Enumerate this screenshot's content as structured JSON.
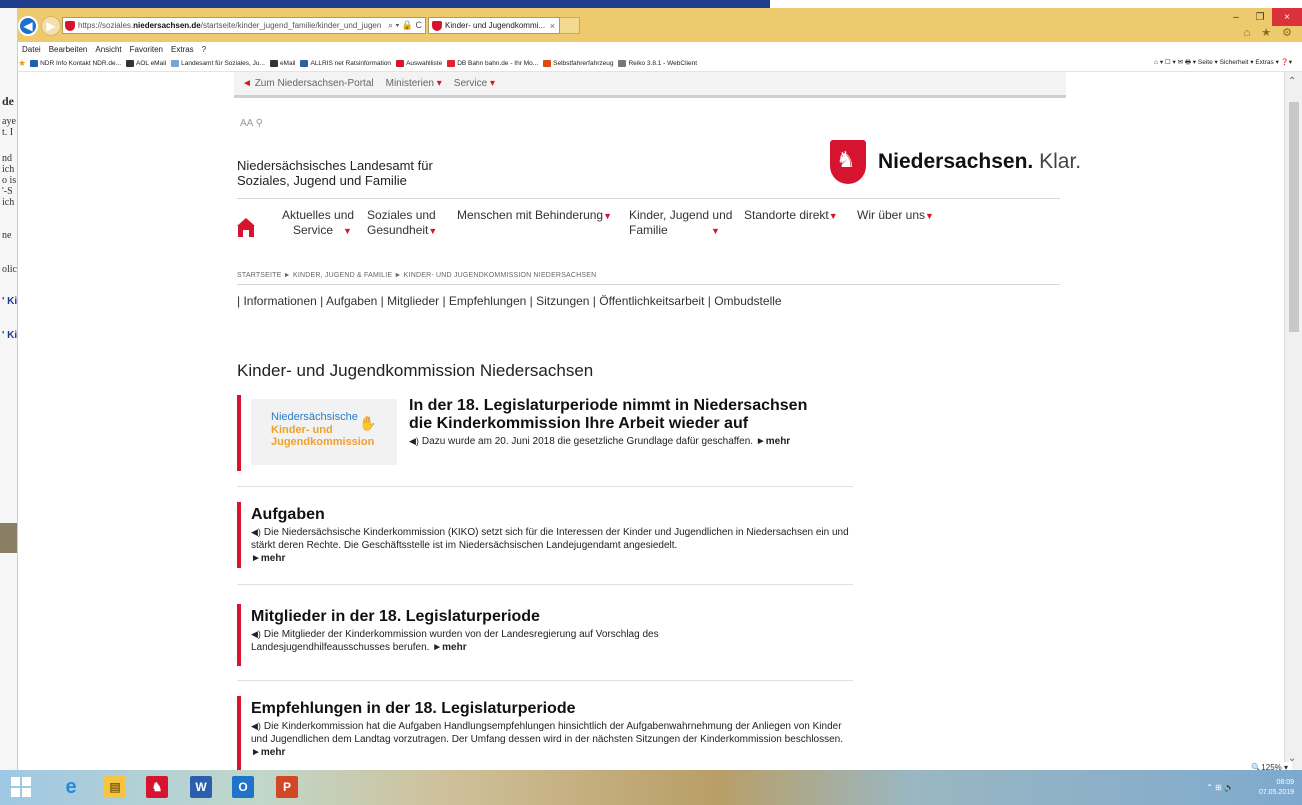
{
  "browser": {
    "url_prefix": "https://soziales.",
    "url_domain": "niedersachsen.de",
    "url_rest": "/startseite/kinder_jugend_familie/kinder_und_jugen",
    "addr_icons": "⌕ ▾ 🔒 C",
    "tab_title": "Kinder- und Jugendkommi...",
    "tab_close": "×",
    "minimize": "–",
    "maximize": "❐",
    "close": "×",
    "right_icons": "⌂ ★ ⚙"
  },
  "menubar": [
    "Datei",
    "Bearbeiten",
    "Ansicht",
    "Favoriten",
    "Extras",
    "?"
  ],
  "favorites": [
    {
      "label": "NDR Info Kontakt NDR.de...",
      "color": "#1f5fb0"
    },
    {
      "label": "AOL eMail",
      "color": "#333333"
    },
    {
      "label": "Landesamt für Soziales, Ju...",
      "color": "#7aa4d6"
    },
    {
      "label": "eMail",
      "color": "#333333"
    },
    {
      "label": "ALLRIS net Ratsinformation",
      "color": "#2b5fad"
    },
    {
      "label": "Auswahlliste",
      "color": "#d7142f"
    },
    {
      "label": "DB Bahn bahn.de - Ihr Mo...",
      "color": "#e0242f"
    },
    {
      "label": "Selbstfahrerfahrzeug",
      "color": "#d94d13"
    },
    {
      "label": "Reiko 3.8.1 - WebClient",
      "color": "#777777"
    }
  ],
  "commandbar": "⌂ ▾  ☐ ▾  ✉  🖶 ▾  Seite ▾  Sicherheit ▾  Extras ▾  ❓▾",
  "page": {
    "portal_link": "Zum Niedersachsen-Portal",
    "ministerien": "Ministerien",
    "service": "Service",
    "tools": "AA  ⚲",
    "org_line1": "Niedersächsisches Landesamt für",
    "org_line2": "Soziales, Jugend und Familie",
    "brand_bold": "Niedersachsen.",
    "brand_light": "Klar.",
    "nav": [
      {
        "l1": "Aktuelles und",
        "l2": "Service"
      },
      {
        "l1": "Soziales und",
        "l2": "Gesundheit"
      },
      {
        "l1": "Menschen mit Behinderung",
        "l2": ""
      },
      {
        "l1": "Kinder, Jugend und",
        "l2": "Familie"
      },
      {
        "l1": "Standorte direkt",
        "l2": ""
      },
      {
        "l1": "Wir über uns",
        "l2": ""
      }
    ],
    "breadcrumb": "STARTSEITE   ► KINDER, JUGEND & FAMILIE   ► KINDER- UND JUGENDKOMMISSION NIEDERSACHSEN",
    "subnav": "|  Informationen  |  Aufgaben  |  Mitglieder  |  Empfehlungen  |  Sitzungen  |  Öffentlichkeitsarbeit  |  Ombudstelle",
    "section_title": "Kinder- und Jugendkommission Niedersachsen",
    "teasers": [
      {
        "title_l1": "In der 18. Legislaturperiode nimmt in Niedersachsen",
        "title_l2": "die Kinderkommission Ihre Arbeit wieder auf",
        "text": "Dazu wurde am 20. Juni 2018 die gesetzliche Grundlage dafür geschaffen.",
        "more": "►mehr",
        "logo_l1": "Niedersächsische",
        "logo_l2": "Kinder- und",
        "logo_l3": "Jugendkommission"
      },
      {
        "title": "Aufgaben",
        "text": "Die Niedersächsische Kinderkommission (KIKO) setzt sich für die Interessen der Kinder und Jugendlichen in Niedersachsen ein und stärkt deren Rechte. Die Geschäftsstelle ist im Niedersächsischen Landejugendamt angesiedelt.",
        "more": "►mehr"
      },
      {
        "title": "Mitglieder in der 18. Legislaturperiode",
        "text": "Die Mitglieder der Kinderkommission wurden von der Landesregierung auf Vorschlag des Landesjugendhilfeausschusses berufen.",
        "more": "►mehr"
      },
      {
        "title": "Empfehlungen in der 18. Legislaturperiode",
        "text": "Die Kinderkommission hat die Aufgaben Handlungsempfehlungen hinsichtlich der Aufgabenwahrnehmung der Anliegen von Kinder und Jugendlichen dem Landtag vorzutragen. Der Umfang dessen wird in der nächsten Sitzungen der Kinderkommission beschlossen.",
        "more": "►mehr"
      }
    ]
  },
  "zoom": "🔍125%  ▾",
  "taskbar": {
    "time": "08:09",
    "date": "07.05.2019",
    "tray": "⌃  ⊞  🔈"
  },
  "bg_fragments": [
    "de",
    "aye",
    "t. I",
    "nd",
    "ich",
    "o is",
    "'-S",
    "ich",
    "ne",
    "olic",
    "' Ki",
    "' Ki"
  ],
  "colors": {
    "accent": "#d7142f",
    "titlebar": "#eeca6f",
    "ie_blue": "#1e6fd1"
  }
}
